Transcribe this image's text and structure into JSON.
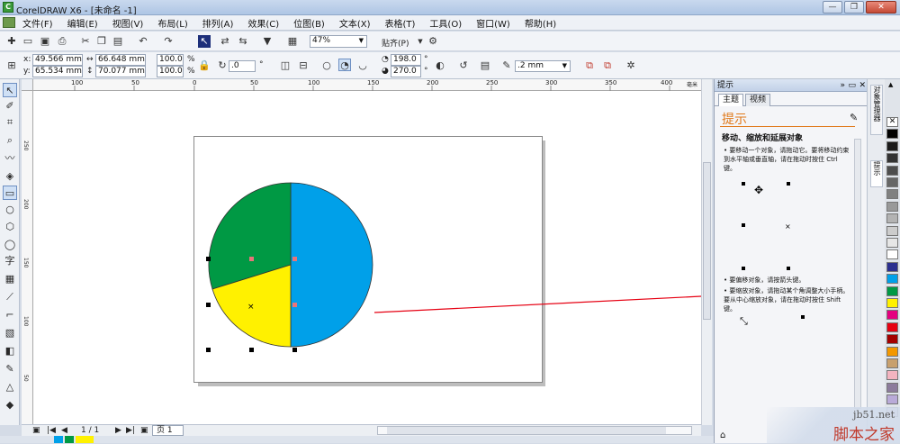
{
  "window": {
    "title": "CorelDRAW X6 - [未命名 -1]",
    "buttons": {
      "minimize": "—",
      "restore": "❐",
      "close": "✕"
    }
  },
  "menu": [
    "文件(F)",
    "编辑(E)",
    "视图(V)",
    "布局(L)",
    "排列(A)",
    "效果(C)",
    "位图(B)",
    "文本(X)",
    "表格(T)",
    "工具(O)",
    "窗口(W)",
    "帮助(H)"
  ],
  "toolbar": {
    "zoom": "47%",
    "snap_label": "贴齐(P)"
  },
  "property_bar": {
    "x_label": "x:",
    "x": "49.566 mm",
    "y_label": "y:",
    "y": "65.534 mm",
    "width": "66.648 mm",
    "height": "70.077 mm",
    "scale_x": "100.0",
    "scale_y": "100.0",
    "pct": "%",
    "rotation": ".0",
    "deg": "°",
    "start_angle": "198.0",
    "end_angle": "270.0",
    "outline_width": ".2 mm"
  },
  "ruler": {
    "h_ticks": [
      "100",
      "50",
      "0",
      "50",
      "100",
      "150",
      "200",
      "250",
      "300",
      "350",
      "400"
    ],
    "h_unit": "毫米",
    "v_ticks": [
      "250",
      "200",
      "150",
      "100",
      "50"
    ]
  },
  "page_nav": {
    "counter": "1 / 1",
    "page_tab": "页 1"
  },
  "docker": {
    "title": "提示",
    "tabs": [
      "主题",
      "视频"
    ],
    "heading": "提示",
    "subheading": "移动、缩放和延展对象",
    "bullets": [
      "要移动一个对象，请拖动它。要将移动约束到水平轴或垂直轴，请在拖动时按住 Ctrl 键。",
      "要偏移对象，请按箭头键。",
      "要缩放对象，请拖动某个角调整大小手柄。要从中心缩放对象，请在拖动时按住 Shift 键。"
    ]
  },
  "side_tabs": [
    "对象管理器",
    "提示"
  ],
  "palette": [
    "#ffffff",
    "#000000",
    "#1a1a1a",
    "#333333",
    "#4d4d4d",
    "#666666",
    "#808080",
    "#999999",
    "#b3b3b3",
    "#cccccc",
    "#e6e6e6",
    "#ffffff",
    "#2b2f8f",
    "#00a0e9",
    "#009944",
    "#fff100",
    "#e4007f",
    "#e60012",
    "#a40000",
    "#f39800",
    "#c8a06e",
    "#f4b4c0",
    "#8c7b9c",
    "#b9aad8",
    "#d4c4e4"
  ],
  "watermark": {
    "site": "jb51.net",
    "name": "脚本之家"
  },
  "shapes": {
    "colors": {
      "blue": "#00a0e9",
      "green": "#009944",
      "yellow": "#fff100",
      "arrow": "#e60012"
    }
  }
}
